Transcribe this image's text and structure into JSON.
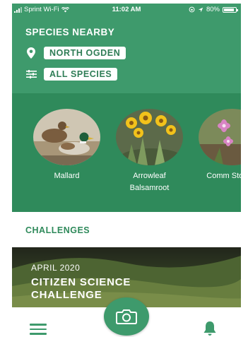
{
  "status_bar": {
    "carrier": "Sprint Wi-Fi",
    "time": "11:02 AM",
    "battery": "80%"
  },
  "header": {
    "title": "SPECIES NEARBY",
    "location": "NORTH OGDEN",
    "species_filter": "ALL SPECIES"
  },
  "species": [
    {
      "name": "Mallard"
    },
    {
      "name": "Arrowleaf Balsamroot"
    },
    {
      "name": "Comm Stork's-"
    }
  ],
  "challenges": {
    "section_title": "CHALLENGES",
    "card": {
      "date": "APRIL 2020",
      "title": "CITIZEN SCIENCE CHALLENGE"
    }
  },
  "colors": {
    "header_green": "#3e9a6c",
    "band_green": "#2f8a5b",
    "accent_text": "#2f7d56"
  },
  "icons": {
    "location": "location-pin-icon",
    "filter": "sliders-icon",
    "camera": "camera-icon",
    "menu": "hamburger-menu-icon",
    "notifications": "bell-icon"
  }
}
